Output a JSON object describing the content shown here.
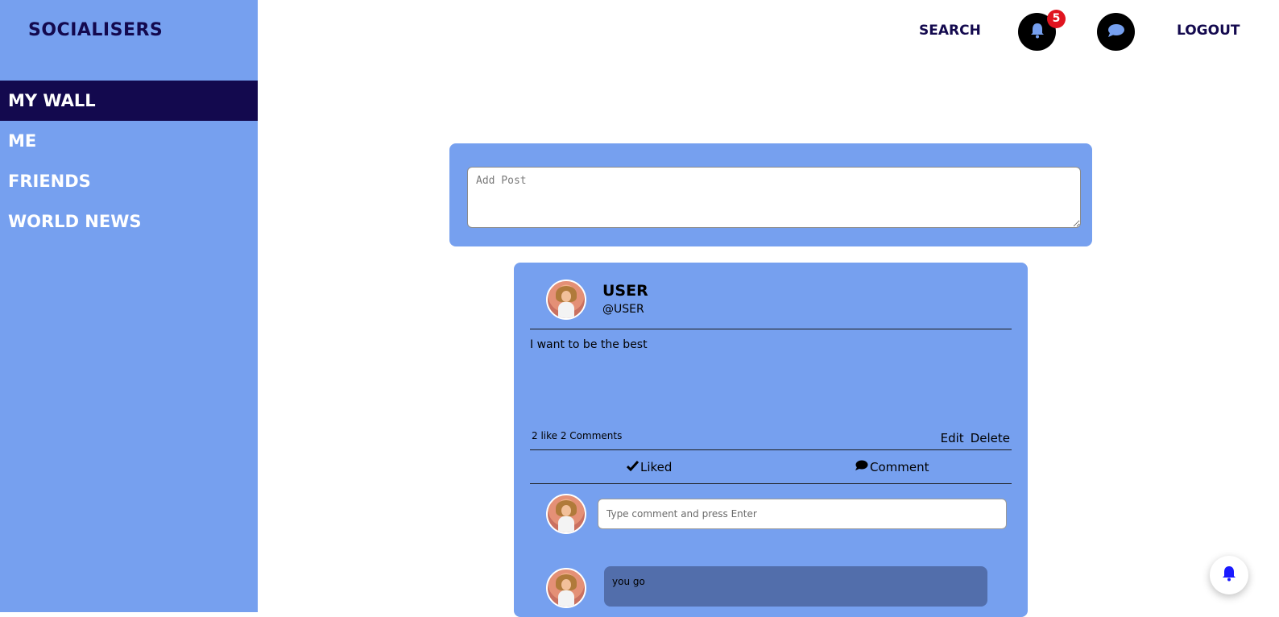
{
  "brand": "SOCIALISERS",
  "nav": {
    "items": [
      {
        "label": "MY WALL",
        "active": true
      },
      {
        "label": "ME",
        "active": false
      },
      {
        "label": "FRIENDS",
        "active": false
      },
      {
        "label": "WORLD NEWS",
        "active": false
      }
    ]
  },
  "topbar": {
    "search_label": "SEARCH",
    "notification_count": "5",
    "logout_label": "LOGOUT",
    "icons": {
      "notifications": "bell-icon",
      "messages": "chat-bubble-icon"
    }
  },
  "composer": {
    "placeholder": "Add Post"
  },
  "post": {
    "user_name": "USER",
    "user_handle": "@USER",
    "text": "I want to be the best",
    "stats": "2 like 2 Comments",
    "edit_label": "Edit",
    "delete_label": "Delete",
    "like_label": "Liked",
    "comment_label": "Comment",
    "comment_placeholder": "Type comment and press Enter",
    "comments": [
      {
        "text": "you go"
      }
    ]
  },
  "colors": {
    "sidebar": "#76a0ef",
    "navy": "#13094e",
    "badge": "#e0141f",
    "comment_bubble": "#526eab"
  }
}
